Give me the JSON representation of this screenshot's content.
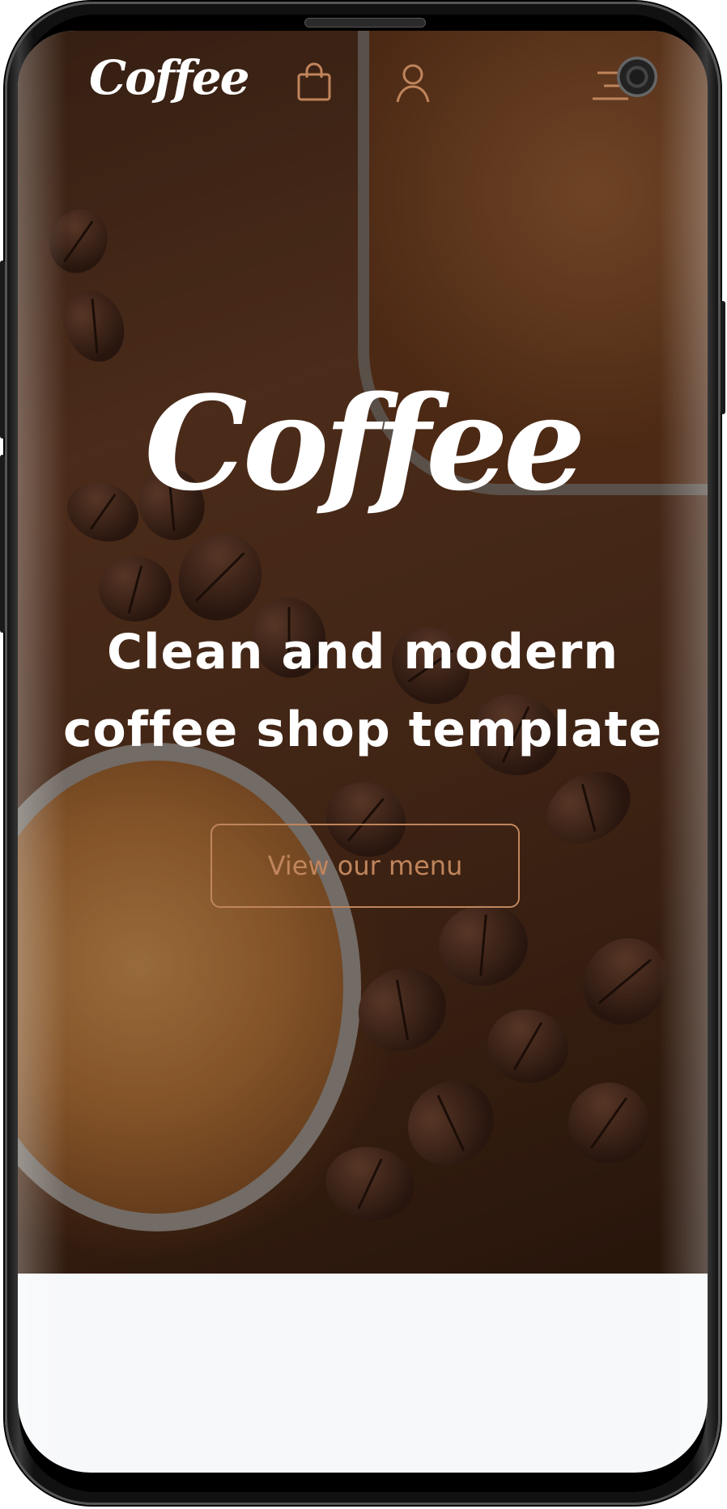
{
  "header": {
    "logo_text": "Coffee",
    "icons": [
      "shopping-bag-icon",
      "user-icon",
      "menu-icon"
    ]
  },
  "hero": {
    "logo_text": "Coffee",
    "tagline_line1": "Clean and modern",
    "tagline_line2": "coffee shop template",
    "cta_label": "View our menu"
  },
  "colors": {
    "accent": "#c0855c",
    "text_light": "#ffffff",
    "lower_panel": "#f7f8fa"
  }
}
